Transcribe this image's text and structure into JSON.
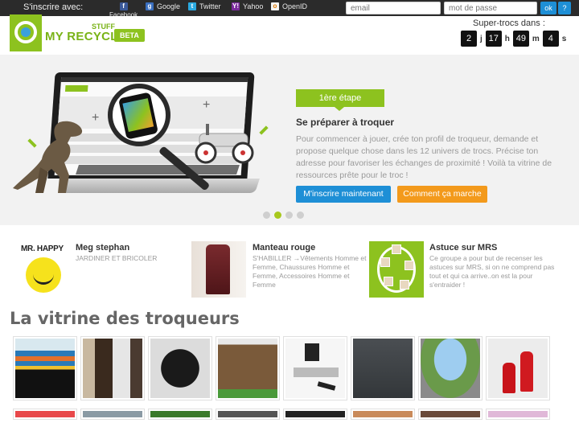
{
  "topbar": {
    "signup_label": "S'inscrire avec:",
    "providers": [
      {
        "label": "Facebook",
        "icon": "facebook-icon"
      },
      {
        "label": "Google",
        "icon": "google-icon"
      },
      {
        "label": "Twitter",
        "icon": "twitter-icon"
      },
      {
        "label": "Yahoo",
        "icon": "yahoo-icon"
      },
      {
        "label": "OpenID",
        "icon": "openid-icon"
      }
    ],
    "email_placeholder": "email",
    "password_placeholder": "mot de passe",
    "ok_label": "ok",
    "help_label": "?"
  },
  "header": {
    "logo_stuff": "STUFF",
    "logo_name": "MY RECYCLE",
    "beta": "BETA",
    "countdown_label": "Super-trocs dans :",
    "countdown": [
      {
        "value": "2",
        "unit": "j"
      },
      {
        "value": "17",
        "unit": "h"
      },
      {
        "value": "49",
        "unit": "m"
      },
      {
        "value": "4",
        "unit": "s"
      }
    ]
  },
  "hero": {
    "step": "1ère étape",
    "title": "Se préparer à troquer",
    "text": "Pour commencer à jouer, crée ton profil de troqueur, demande et propose quelque chose dans les 12 univers de trocs. Précise ton adresse pour favoriser les échanges de proximité ! Voilà ta vitrine de ressources prête pour le troc !",
    "btn_signup": "M'inscrire maintenant",
    "btn_how": "Comment ça marche",
    "slides": 4,
    "active_slide": 2
  },
  "featured": [
    {
      "title": "Meg stephan",
      "subtitle": "JARDINER ET BRICOLER",
      "image_text": "MR. HAPPY"
    },
    {
      "title": "Manteau rouge",
      "subtitle": "S'HABILLER →Vêtements Homme et Femme, Chaussures Homme et Femme, Accessoires Homme et Femme"
    },
    {
      "title": "Astuce sur MRS",
      "subtitle": "Ce groupe a pour but de recenser les astuces sur MRS, si on ne comprend pas tout et qui ca arrive..on est la pour s'entraider !"
    }
  ],
  "vitrine": {
    "title": "La vitrine des troqueurs"
  },
  "colors": {
    "accent_green": "#8dc21f",
    "accent_blue": "#1e8fd6",
    "accent_orange": "#f39a1c"
  }
}
